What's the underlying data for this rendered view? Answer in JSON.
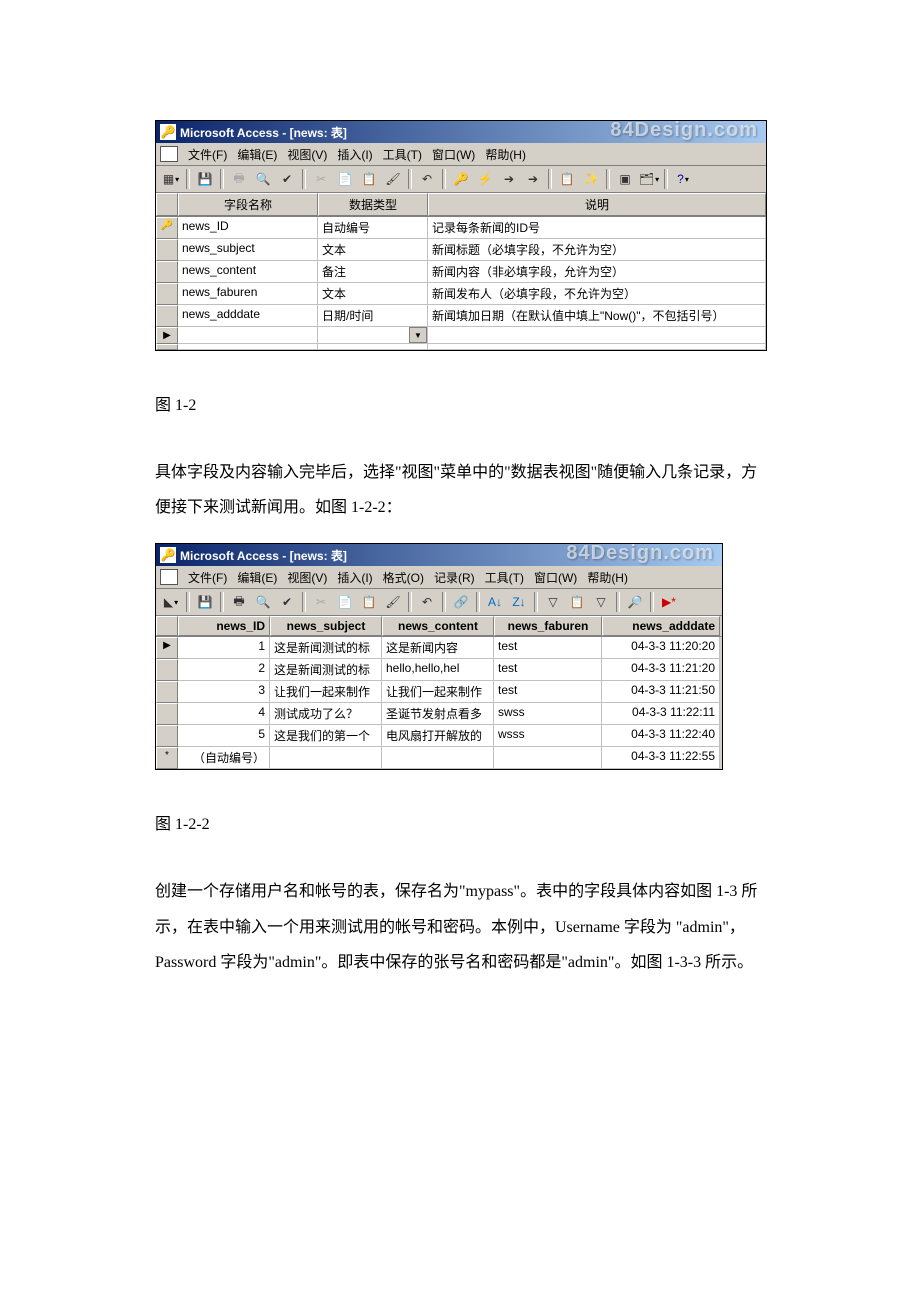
{
  "window1": {
    "title": "Microsoft Access - [news: 表]",
    "watermark": "84Design.com",
    "menus": [
      "文件(F)",
      "编辑(E)",
      "视图(V)",
      "插入(I)",
      "工具(T)",
      "窗口(W)",
      "帮助(H)"
    ],
    "columns": [
      "字段名称",
      "数据类型",
      "说明"
    ],
    "rows": [
      {
        "sel": "🔑",
        "name": "news_ID",
        "type": "自动编号",
        "desc": "记录每条新闻的ID号"
      },
      {
        "sel": "",
        "name": "news_subject",
        "type": "文本",
        "desc": "新闻标题（必填字段，不允许为空）"
      },
      {
        "sel": "",
        "name": "news_content",
        "type": "备注",
        "desc": "新闻内容（非必填字段，允许为空）"
      },
      {
        "sel": "",
        "name": "news_faburen",
        "type": "文本",
        "desc": "新闻发布人（必填字段，不允许为空）"
      },
      {
        "sel": "",
        "name": "news_adddate",
        "type": "日期/时间",
        "desc": "新闻填加日期（在默认值中填上\"Now()\"，不包括引号）"
      },
      {
        "sel": "▶",
        "name": "",
        "type": "",
        "desc": "",
        "showDrop": true
      },
      {
        "sel": "",
        "name": "",
        "type": "",
        "desc": ""
      }
    ]
  },
  "caption1": "图 1-2",
  "para1": "具体字段及内容输入完毕后，选择\"视图\"菜单中的\"数据表视图\"随便输入几条记录，方便接下来测试新闻用。如图 1-2-2：",
  "window2": {
    "title": "Microsoft Access - [news: 表]",
    "watermark": "84Design.com",
    "menus": [
      "文件(F)",
      "编辑(E)",
      "视图(V)",
      "插入(I)",
      "格式(O)",
      "记录(R)",
      "工具(T)",
      "窗口(W)",
      "帮助(H)"
    ],
    "columns": [
      "news_ID",
      "news_subject",
      "news_content",
      "news_faburen",
      "news_adddate"
    ],
    "rows": [
      {
        "sel": "▶",
        "id": "1",
        "subj": "这是新闻测试的标",
        "cont": "这是新闻内容",
        "fab": "test",
        "date": "04-3-3 11:20:20"
      },
      {
        "sel": "",
        "id": "2",
        "subj": "这是新闻测试的标",
        "cont": "hello,hello,hel",
        "fab": "test",
        "date": "04-3-3 11:21:20"
      },
      {
        "sel": "",
        "id": "3",
        "subj": "让我们一起来制作",
        "cont": "让我们一起来制作",
        "fab": "test",
        "date": "04-3-3 11:21:50"
      },
      {
        "sel": "",
        "id": "4",
        "subj": "测试成功了么？",
        "cont": "圣诞节发射点看多",
        "fab": "swss",
        "date": "04-3-3 11:22:11"
      },
      {
        "sel": "",
        "id": "5",
        "subj": "这是我们的第一个",
        "cont": "电风扇打开解放的",
        "fab": "wsss",
        "date": "04-3-3 11:22:40"
      },
      {
        "sel": "*",
        "id": "（自动编号）",
        "subj": "",
        "cont": "",
        "fab": "",
        "date": "04-3-3 11:22:55"
      }
    ]
  },
  "caption2": "图 1-2-2",
  "para2": "创建一个存储用户名和帐号的表，保存名为\"mypass\"。表中的字段具体内容如图 1-3 所示，在表中输入一个用来测试用的帐号和密码。本例中，Username 字段为 \"admin\"，Password 字段为\"admin\"。即表中保存的张号名和密码都是\"admin\"。如图 1-3-3 所示。"
}
